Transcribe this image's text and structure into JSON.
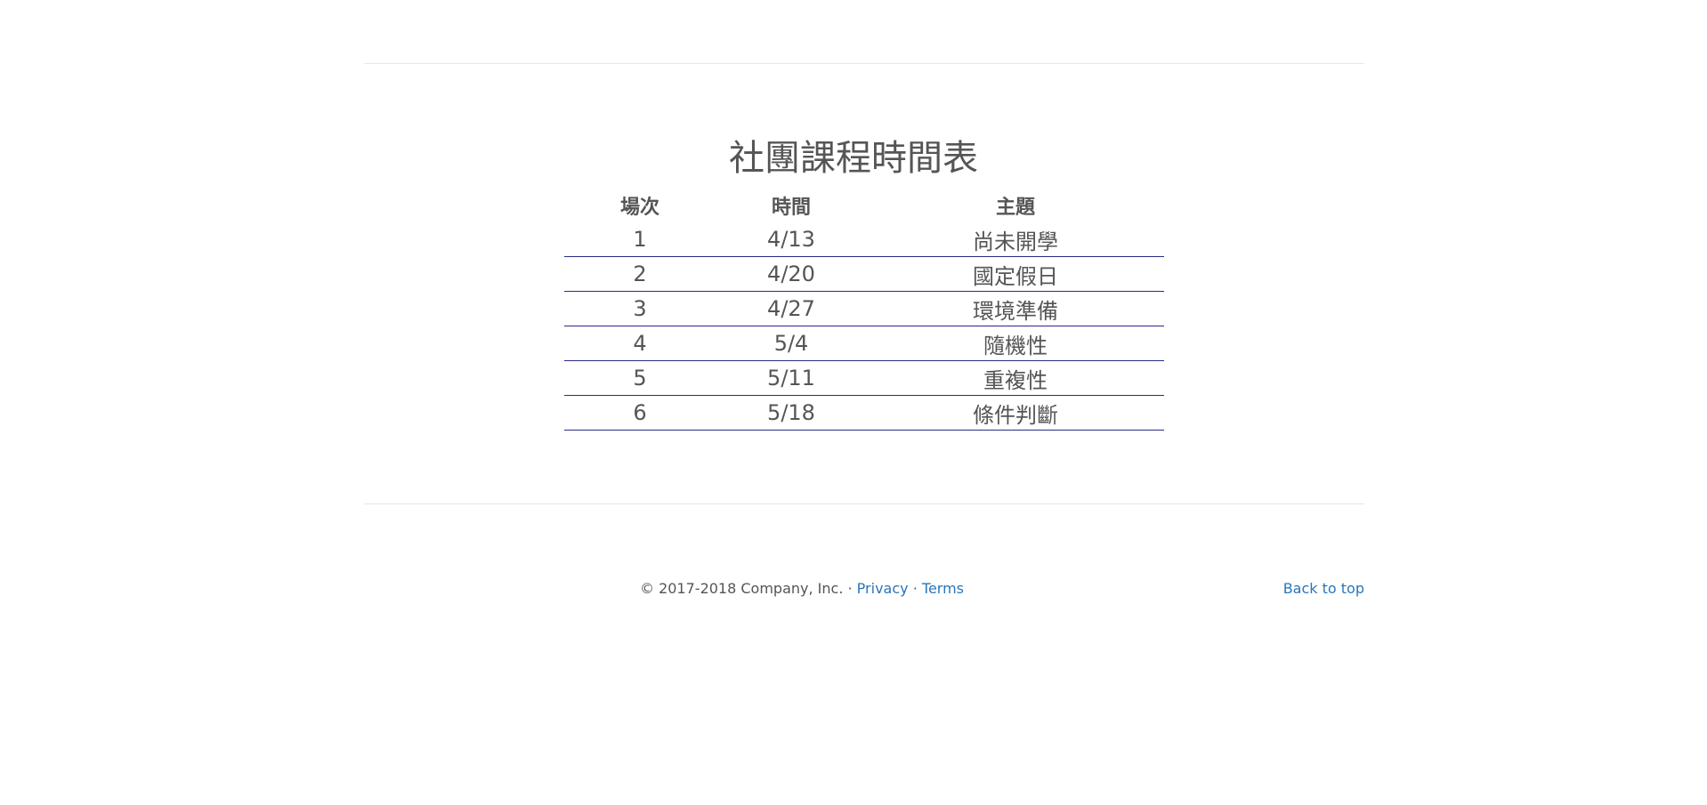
{
  "schedule": {
    "title": "社團課程時間表",
    "headers": {
      "session": "場次",
      "date": "時間",
      "topic": "主題"
    },
    "rows": [
      {
        "session": "1",
        "date": "4/13",
        "topic": "尚未開學"
      },
      {
        "session": "2",
        "date": "4/20",
        "topic": "國定假日"
      },
      {
        "session": "3",
        "date": "4/27",
        "topic": "環境準備"
      },
      {
        "session": "4",
        "date": "5/4",
        "topic": "隨機性"
      },
      {
        "session": "5",
        "date": "5/11",
        "topic": "重複性"
      },
      {
        "session": "6",
        "date": "5/18",
        "topic": "條件判斷"
      }
    ]
  },
  "footer": {
    "copyright": "© 2017-2018 Company, Inc. ·",
    "privacy_label": "Privacy",
    "separator": "·",
    "terms_label": "Terms",
    "back_to_top_label": "Back to top"
  },
  "colors": {
    "row_border": "#2a2a8a",
    "link": "#2a75bb",
    "text": "#555555",
    "divider": "#e7e7e7"
  }
}
